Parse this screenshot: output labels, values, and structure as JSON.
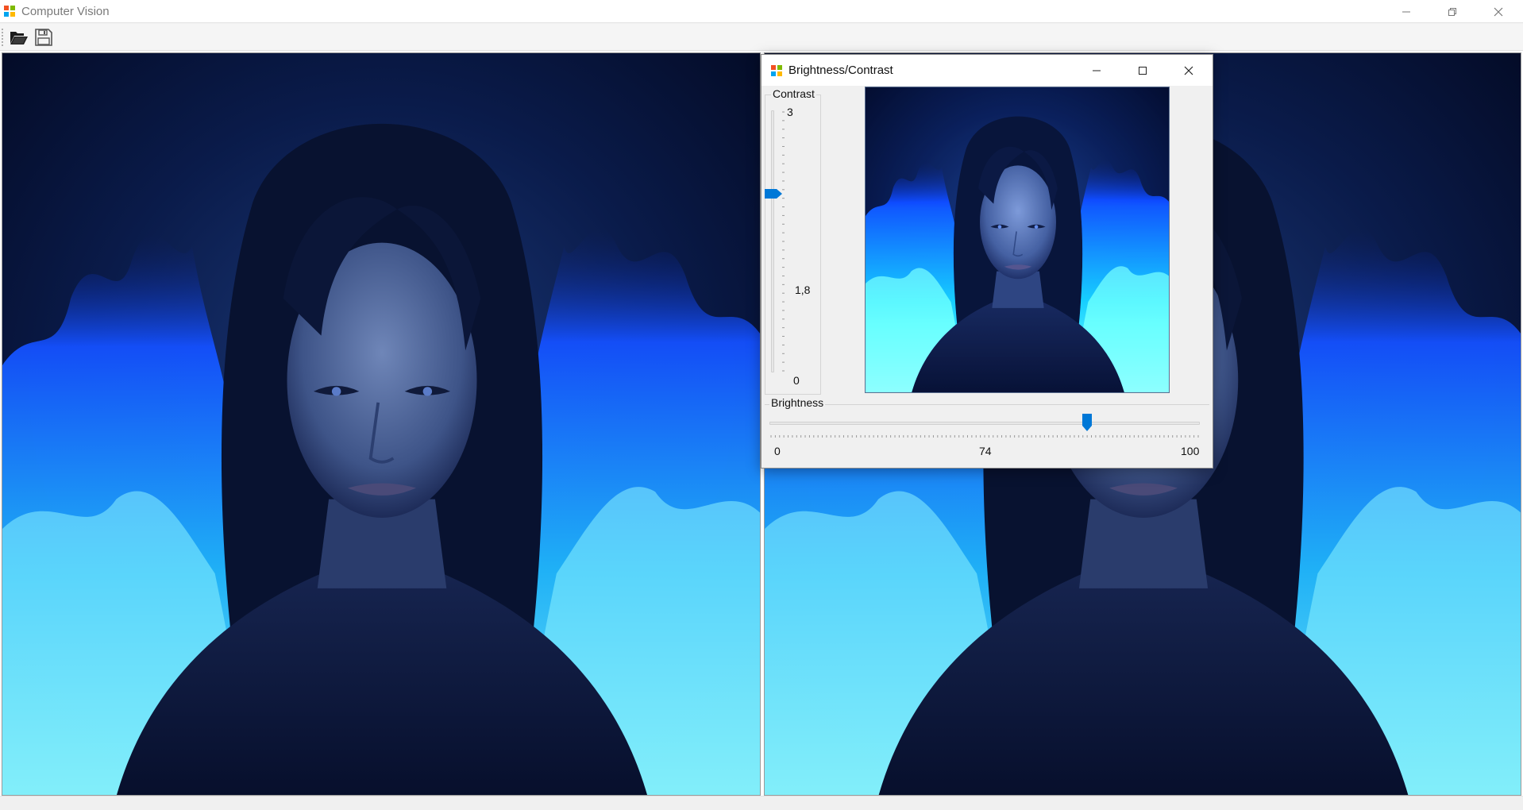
{
  "window": {
    "title": "Computer Vision"
  },
  "toolbar": {
    "open_icon": "folder-open-icon",
    "save_icon": "floppy-save-icon"
  },
  "dialog": {
    "title": "Brightness/Contrast",
    "contrast": {
      "label": "Contrast",
      "tick_max": "3",
      "tick_mid": "1,8",
      "tick_min": "0",
      "min": 0,
      "max": 3,
      "value": 2.05
    },
    "brightness": {
      "label": "Brightness",
      "tick_min": "0",
      "tick_mid": "74",
      "tick_max": "100",
      "min": 0,
      "max": 100,
      "value": 74
    }
  },
  "colors": {
    "accent": "#0078d7",
    "flame": "#1e90ff",
    "background": "#06102e"
  }
}
